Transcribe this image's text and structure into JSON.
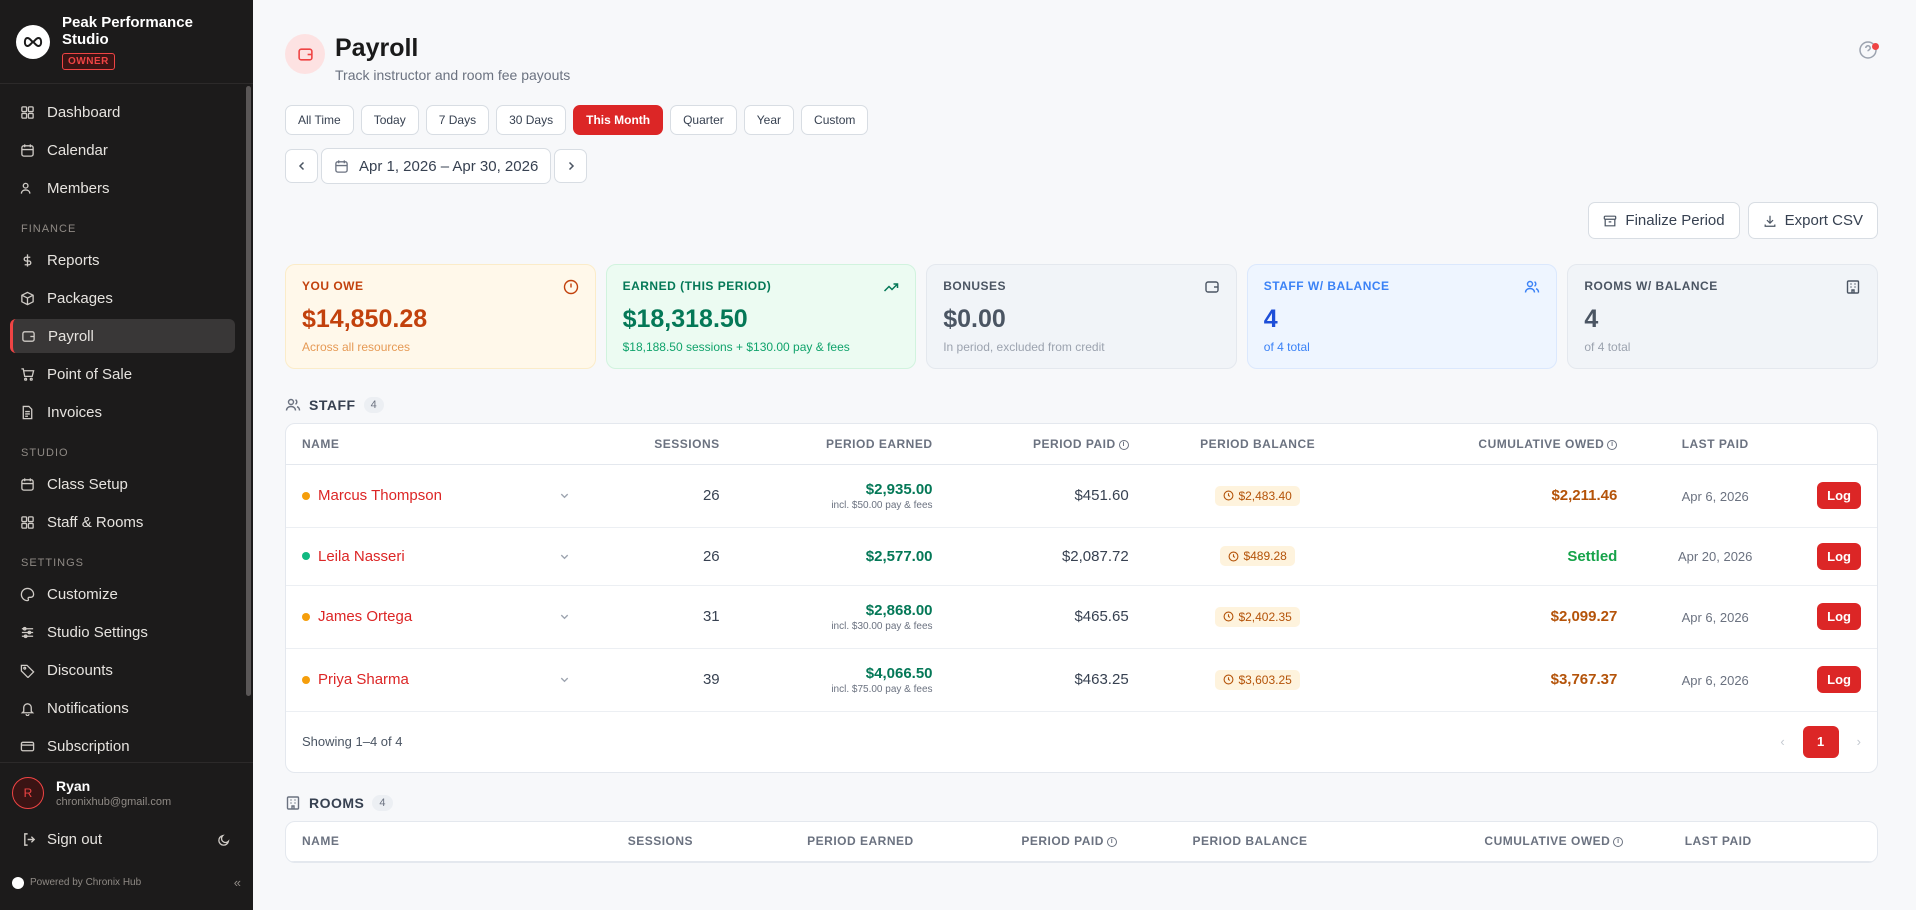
{
  "brand": {
    "name": "Peak Performance Studio",
    "role_badge": "OWNER"
  },
  "nav": {
    "main": [
      {
        "label": "Dashboard",
        "icon": "grid-icon"
      },
      {
        "label": "Calendar",
        "icon": "calendar-icon"
      },
      {
        "label": "Members",
        "icon": "users-icon"
      }
    ],
    "finance_label": "FINANCE",
    "finance": [
      {
        "label": "Reports",
        "icon": "dollar-icon"
      },
      {
        "label": "Packages",
        "icon": "package-icon"
      },
      {
        "label": "Payroll",
        "icon": "wallet-icon",
        "active": true
      },
      {
        "label": "Point of Sale",
        "icon": "cart-icon"
      },
      {
        "label": "Invoices",
        "icon": "invoice-icon"
      }
    ],
    "studio_label": "STUDIO",
    "studio": [
      {
        "label": "Class Setup",
        "icon": "calendar-icon"
      },
      {
        "label": "Staff & Rooms",
        "icon": "grid-icon"
      }
    ],
    "settings_label": "SETTINGS",
    "settings": [
      {
        "label": "Customize",
        "icon": "palette-icon"
      },
      {
        "label": "Studio Settings",
        "icon": "sliders-icon"
      },
      {
        "label": "Discounts",
        "icon": "tag-icon"
      },
      {
        "label": "Notifications",
        "icon": "bell-icon"
      },
      {
        "label": "Subscription",
        "icon": "card-icon"
      }
    ]
  },
  "user": {
    "initial": "R",
    "name": "Ryan",
    "email": "chronixhub@gmail.com",
    "sign_out": "Sign out"
  },
  "footer": {
    "powered": "Powered by Chronix Hub"
  },
  "header": {
    "title": "Payroll",
    "subtitle": "Track instructor and room fee payouts"
  },
  "filters": [
    "All Time",
    "Today",
    "7 Days",
    "30 Days",
    "This Month",
    "Quarter",
    "Year",
    "Custom"
  ],
  "active_filter": "This Month",
  "date_range": "Apr 1, 2026 – Apr 30, 2026",
  "actions": {
    "finalize": "Finalize Period",
    "export": "Export CSV"
  },
  "cards": {
    "owe": {
      "label": "YOU OWE",
      "value": "$14,850.28",
      "sub": "Across all resources"
    },
    "earned": {
      "label": "EARNED (THIS PERIOD)",
      "value": "$18,318.50",
      "sub": "$18,188.50 sessions + $130.00 pay & fees"
    },
    "bonuses": {
      "label": "BONUSES",
      "value": "$0.00",
      "sub": "In period, excluded from credit"
    },
    "staff": {
      "label": "STAFF W/ BALANCE",
      "value": "4",
      "sub": "of 4 total"
    },
    "rooms": {
      "label": "ROOMS W/ BALANCE",
      "value": "4",
      "sub": "of 4 total"
    }
  },
  "staff": {
    "title": "STAFF",
    "count": "4",
    "columns": [
      "NAME",
      "SESSIONS",
      "PERIOD EARNED",
      "PERIOD PAID",
      "PERIOD BALANCE",
      "CUMULATIVE OWED",
      "LAST PAID"
    ],
    "rows": [
      {
        "name": "Marcus Thompson",
        "sessions": "26",
        "earned": "$2,935.00",
        "incl": "incl. $50.00 pay & fees",
        "paid": "$451.60",
        "balance": "$2,483.40",
        "owed": "$2,211.46",
        "last_paid": "Apr 6, 2026",
        "log": "Log"
      },
      {
        "name": "Leila Nasseri",
        "sessions": "26",
        "earned": "$2,577.00",
        "incl": "",
        "paid": "$2,087.72",
        "balance": "$489.28",
        "owed": "Settled",
        "last_paid": "Apr 20, 2026",
        "log": "Log"
      },
      {
        "name": "James Ortega",
        "sessions": "31",
        "earned": "$2,868.00",
        "incl": "incl. $30.00 pay & fees",
        "paid": "$465.65",
        "balance": "$2,402.35",
        "owed": "$2,099.27",
        "last_paid": "Apr 6, 2026",
        "log": "Log"
      },
      {
        "name": "Priya Sharma",
        "sessions": "39",
        "earned": "$4,066.50",
        "incl": "incl. $75.00 pay & fees",
        "paid": "$463.25",
        "balance": "$3,603.25",
        "owed": "$3,767.37",
        "last_paid": "Apr 6, 2026",
        "log": "Log"
      }
    ],
    "showing": "Showing 1–4 of 4",
    "page": "1"
  },
  "rooms": {
    "title": "ROOMS",
    "count": "4",
    "columns": [
      "NAME",
      "SESSIONS",
      "PERIOD EARNED",
      "PERIOD PAID",
      "PERIOD BALANCE",
      "CUMULATIVE OWED",
      "LAST PAID"
    ]
  },
  "colors": {
    "accent": "#dc2626",
    "sidebar": "#1c1b1b"
  }
}
